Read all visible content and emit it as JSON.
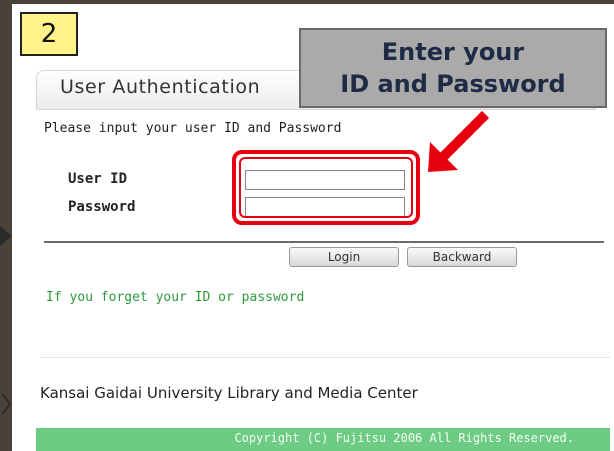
{
  "step": {
    "number": "2"
  },
  "callout": {
    "line1": "Enter your",
    "line2": "ID and Password"
  },
  "auth": {
    "title": "User Authentication",
    "instruction": "Please input your user ID and Password",
    "userid_label": "User ID",
    "password_label": "Password",
    "userid_value": "",
    "password_value": ""
  },
  "buttons": {
    "login": "Login",
    "backward": "Backward"
  },
  "links": {
    "forgot": "If you forget your ID or password"
  },
  "footer": {
    "org": "Kansai Gaidai University Library and Media Center",
    "copyright": "Copyright (C) Fujitsu 2006 All Rights Reserved."
  },
  "colors": {
    "highlight": "#e6000f",
    "footer_bar": "#6ecb84",
    "link": "#2f9a3c",
    "badge": "#fff38a",
    "callout": "#aaaaaa"
  }
}
